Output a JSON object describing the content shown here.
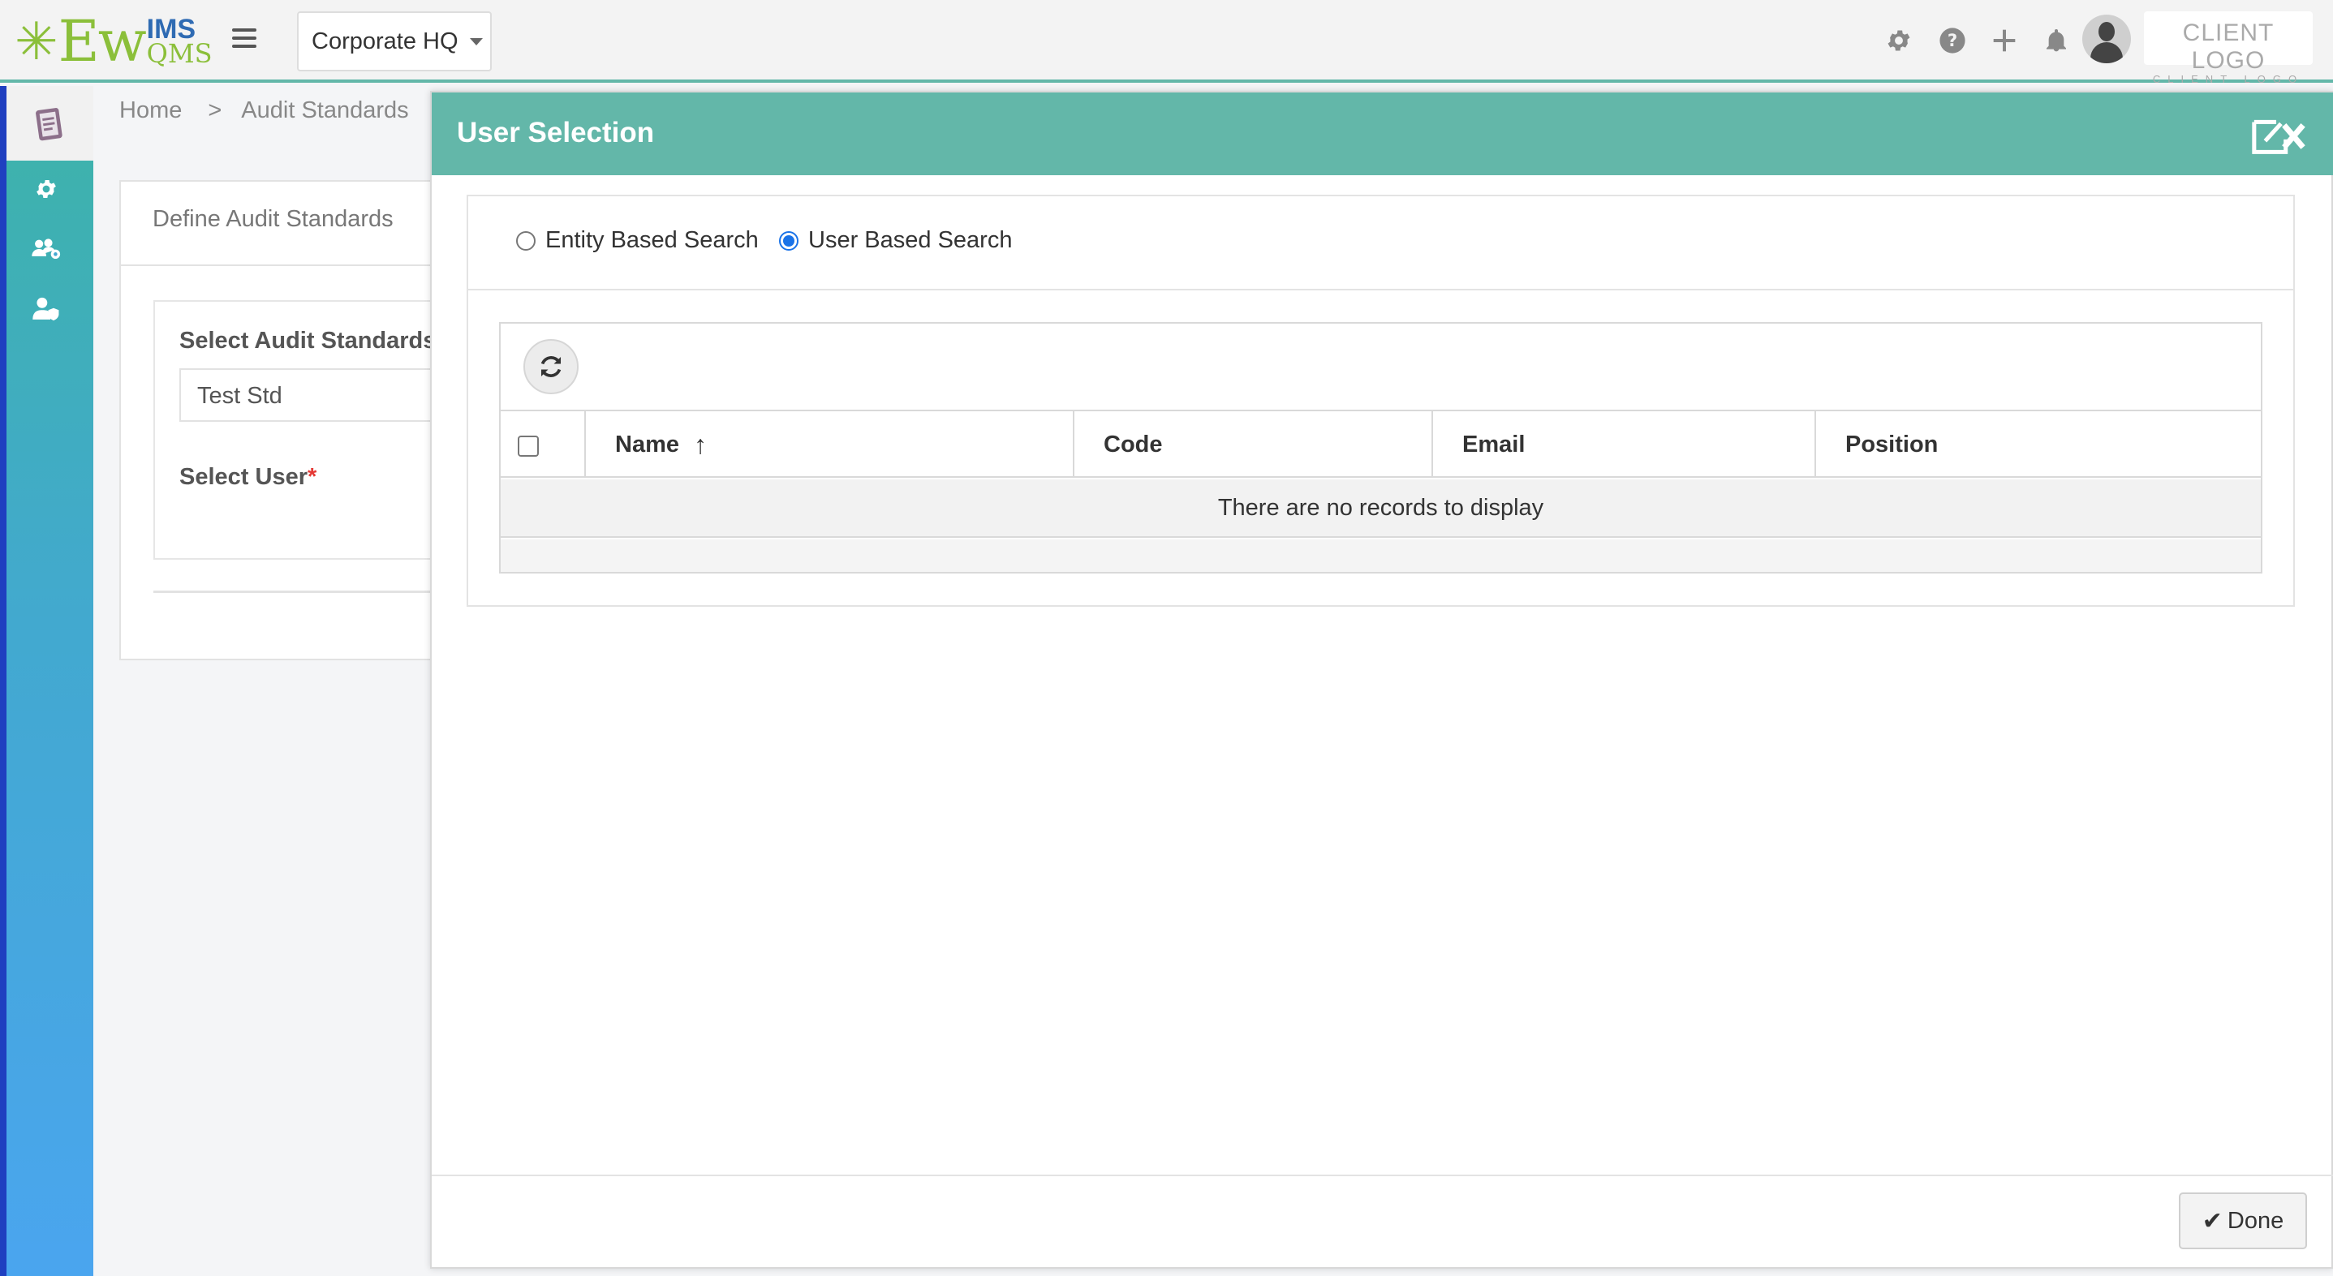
{
  "topbar": {
    "logo": {
      "ew": "Ew",
      "ims": "IMS",
      "qms": "QMS"
    },
    "site_selector": {
      "value": "Corporate HQ"
    },
    "client_logo": {
      "main": "CLIENT LOGO",
      "sub": "CLIENT LOGO"
    },
    "icons": [
      "gear-icon",
      "help-icon",
      "plus-icon",
      "bell-icon",
      "user-avatar"
    ]
  },
  "sidebar": {
    "icons": [
      "clipboard-icon",
      "gear-icon",
      "users-gear-icon",
      "user-shield-icon"
    ]
  },
  "breadcrumb": {
    "home": "Home",
    "separator": ">",
    "current": "Audit Standards"
  },
  "page": {
    "card_title": "Define Audit Standards",
    "select_standards_label": "Select Audit Standards",
    "standards_value": "Test Std",
    "select_user_label": "Select User",
    "required_mark": "*"
  },
  "modal": {
    "title": "User Selection",
    "search_modes": [
      {
        "label": "Entity Based Search",
        "selected": false
      },
      {
        "label": "User Based Search",
        "selected": true
      }
    ],
    "grid": {
      "columns": [
        "Name",
        "Code",
        "Email",
        "Position"
      ],
      "sort_indicator": "↑",
      "empty_message": "There are no records to display",
      "rows": []
    },
    "done_label": "Done"
  },
  "colors": {
    "accent": "#63b7a9",
    "rail_edge": "#1f3fc0",
    "required": "#e53935",
    "radio_selected": "#1a73e8"
  }
}
